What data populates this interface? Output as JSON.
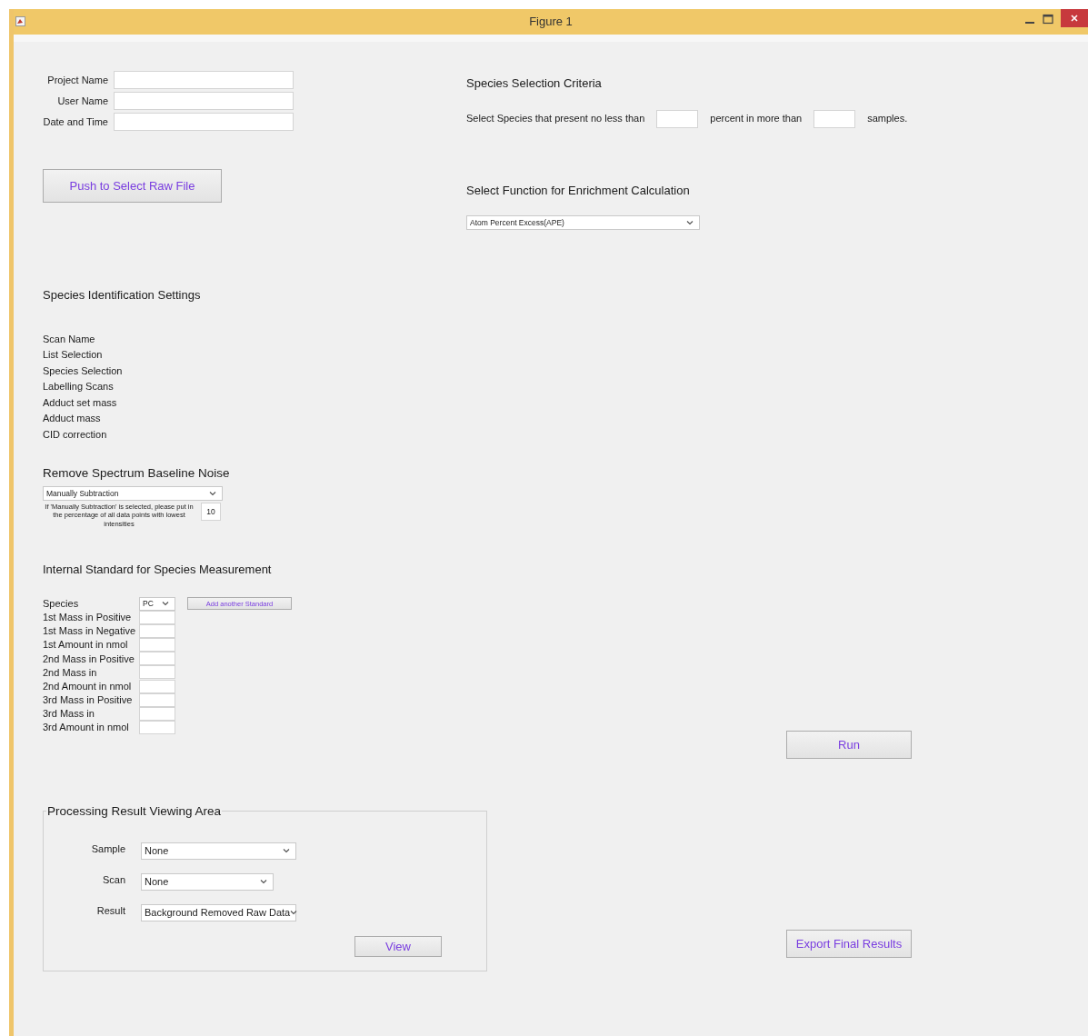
{
  "window": {
    "title": "Figure 1"
  },
  "identity_fields": [
    {
      "label": "Project Name"
    },
    {
      "label": "User Name"
    },
    {
      "label": "Date and Time"
    }
  ],
  "select_raw_file_button": {
    "label": "Push to Select Raw File"
  },
  "species_selection_criteria": {
    "heading": "Species Selection Criteria",
    "segments": [
      {
        "kind": "text",
        "text": "Select Species that present no less than"
      },
      {
        "kind": "field"
      },
      {
        "kind": "text",
        "text": "percent in more than"
      },
      {
        "kind": "field"
      },
      {
        "kind": "text",
        "text": "samples."
      }
    ]
  },
  "enrichment": {
    "heading": "Select Function for Enrichment Calculation",
    "value": "Atom Percent Excess(APE)"
  },
  "species_identification": {
    "heading": "Species Identification Settings",
    "items": [
      "Scan Name",
      "List Selection",
      "Species Selection",
      "Labelling Scans",
      "Adduct set mass",
      "Adduct mass",
      "CID correction"
    ]
  },
  "baseline": {
    "heading": "Remove Spectrum Baseline Noise",
    "method": "Manually Subtraction",
    "note": "If 'Manually Subtraction' is selected, please put in the percentage of all data points with lowest intensities",
    "percentage": "10"
  },
  "internal_standard": {
    "heading": "Internal Standard for Species Measurement",
    "add_button": "Add another Standard",
    "rows": [
      {
        "label": "Species",
        "kind": "dropdown",
        "value": "PC"
      },
      {
        "label": "1st Mass in Positive",
        "kind": "field"
      },
      {
        "label": "1st Mass in Negative",
        "kind": "field"
      },
      {
        "label": "1st Amount in nmol",
        "kind": "field"
      },
      {
        "label": "2nd Mass in Positive",
        "kind": "field"
      },
      {
        "label": "2nd Mass in",
        "kind": "field"
      },
      {
        "label": "2nd Amount in nmol",
        "kind": "field"
      },
      {
        "label": "3rd Mass in Positive",
        "kind": "field"
      },
      {
        "label": "3rd Mass in",
        "kind": "field"
      },
      {
        "label": "3rd Amount in nmol",
        "kind": "field"
      }
    ]
  },
  "run_button": {
    "label": "Run"
  },
  "result_area": {
    "title": "Processing Result Viewing Area",
    "selectors": [
      {
        "label": "Sample",
        "value": "None"
      },
      {
        "label": "Scan",
        "value": "None"
      },
      {
        "label": "Result",
        "value": "Background Removed Raw Data"
      }
    ],
    "view_button": {
      "label": "View"
    }
  },
  "export_button": {
    "label": "Export Final Results"
  }
}
